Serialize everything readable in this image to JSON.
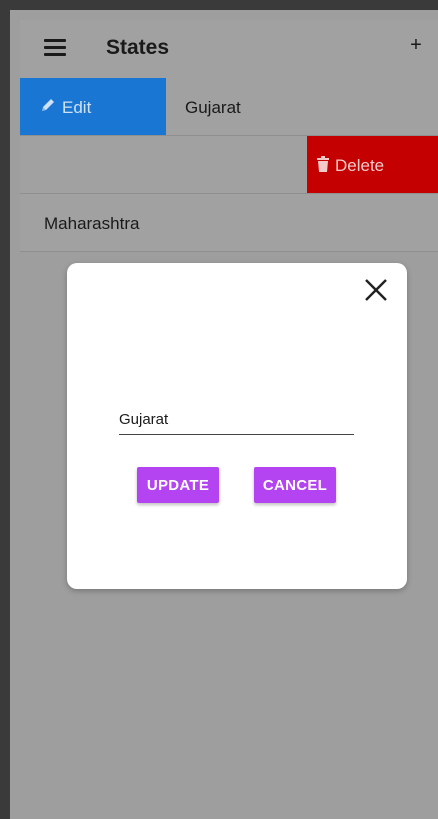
{
  "appbar": {
    "title": "States",
    "menu_icon": "hamburger-menu-icon",
    "add_label": "+"
  },
  "list": {
    "items": [
      {
        "label": "Gujarat",
        "edit_label": "Edit",
        "edit_icon": "pencil-icon",
        "edit_color": "#1976d2"
      },
      {
        "label": "",
        "delete_label": "Delete",
        "delete_icon": "trash-icon",
        "delete_color": "#c40000"
      },
      {
        "label": "Maharashtra"
      }
    ]
  },
  "dialog": {
    "close_icon": "close-icon",
    "input_value": "Gujarat",
    "update_label": "UPDATE",
    "cancel_label": "CANCEL",
    "button_color": "#b444f2"
  }
}
